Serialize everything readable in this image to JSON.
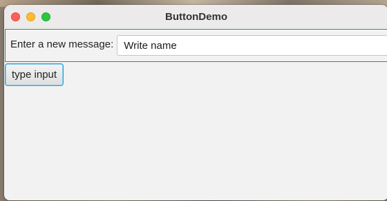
{
  "window": {
    "title": "ButtonDemo"
  },
  "form": {
    "prompt_label": "Enter a new message:",
    "message_value": "Write name",
    "button_label": "type input"
  },
  "colors": {
    "row_border": "#3c8a3c",
    "button_focus": "#2f9fd6",
    "close": "#fe5f57",
    "minimize": "#febc2e",
    "maximize": "#28c840"
  }
}
